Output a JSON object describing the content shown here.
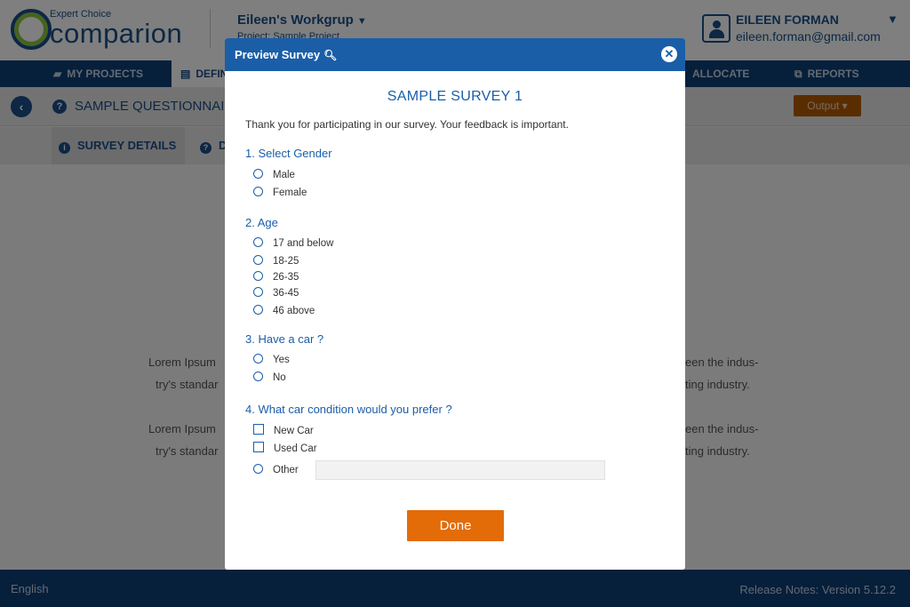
{
  "header": {
    "logo_small": "Expert Choice",
    "logo_big": "comparion",
    "workgroup": "Eileen's Workgrup",
    "project": "Project: Sample Project",
    "user_name": "EILEEN FORMAN",
    "user_email": "eileen.forman@gmail.com"
  },
  "nav": {
    "items": [
      {
        "label": "MY PROJECTS",
        "icon": "folder-icon"
      },
      {
        "label": "DEFINE",
        "icon": "document-icon"
      },
      {
        "label": "ALLOCATE",
        "icon": "allocate-icon"
      },
      {
        "label": "REPORTS",
        "icon": "reports-icon"
      }
    ]
  },
  "subheader": {
    "title": "SAMPLE QUESTIONNAIRE",
    "output_label": "Output"
  },
  "tabs": {
    "survey_details": "SURVEY DETAILS",
    "second_tab": "D"
  },
  "background_text": {
    "line1_left": "Lorem Ipsum",
    "line1_right": "een the indus-",
    "line2_left": "try's standar",
    "line2_right": "ting industry.",
    "line3_left": "Lorem Ipsum",
    "line3_right": "een the indus-",
    "line4_left": "try's standar",
    "line4_right": "ting industry."
  },
  "footer": {
    "language": "English",
    "release": "Release Notes:  Version 5.12.2"
  },
  "modal": {
    "title": "Preview Survey",
    "survey_title": "SAMPLE SURVEY 1",
    "intro": "Thank you for participating in our survey. Your feedback is important.",
    "questions": [
      {
        "label": "1. Select Gender",
        "options": [
          "Male",
          "Female"
        ]
      },
      {
        "label": "2. Age",
        "options": [
          "17 and below",
          "18-25",
          "26-35",
          "36-45",
          "46 above"
        ]
      },
      {
        "label": "3. Have a car ?",
        "options": [
          "Yes",
          "No"
        ]
      },
      {
        "label": "4. What car condition would you prefer ?",
        "options": [
          "New Car",
          "Used Car",
          "Other"
        ]
      }
    ],
    "other_value": "",
    "done_label": "Done"
  },
  "colors": {
    "brand_blue": "#1a5ea8",
    "nav_dark": "#0d3f76",
    "accent_orange": "#e36c09"
  }
}
